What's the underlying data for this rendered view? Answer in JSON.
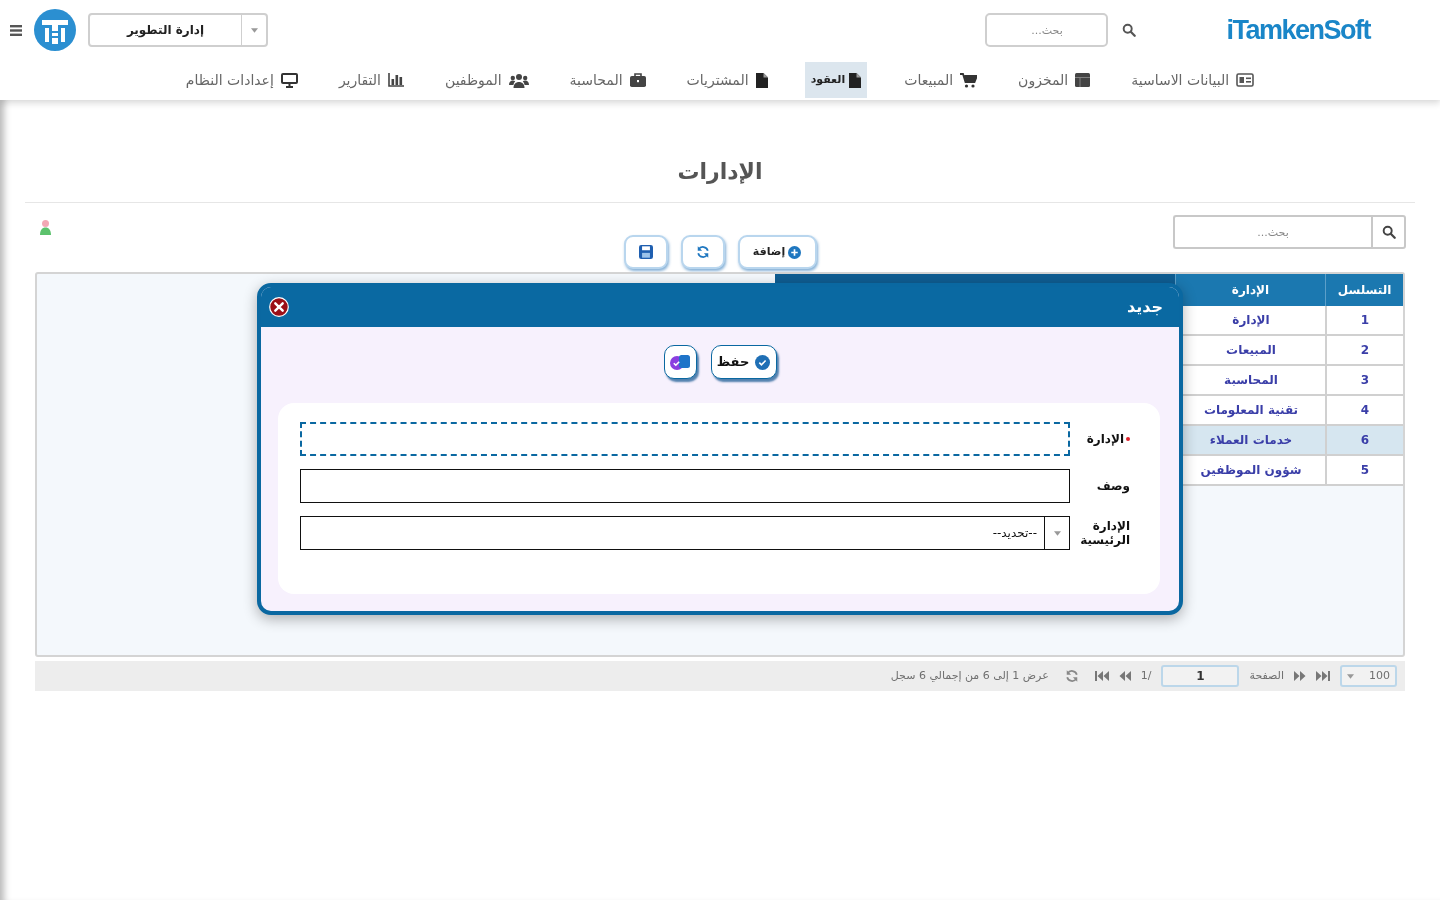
{
  "header": {
    "department_select": {
      "value": "إدارة التطوير"
    },
    "search": {
      "placeholder": "بحث..."
    },
    "brand": {
      "name": "iTamkenSoft"
    }
  },
  "nav": [
    {
      "label": "البيانات الاساسية",
      "selected": false
    },
    {
      "label": "المخزون",
      "selected": false
    },
    {
      "label": "المبيعات",
      "selected": false
    },
    {
      "label": "العقود",
      "selected": true
    },
    {
      "label": "المشتريات",
      "selected": false
    },
    {
      "label": "المحاسبة",
      "selected": false
    },
    {
      "label": "الموظفين",
      "selected": false
    },
    {
      "label": "التقارير",
      "selected": false
    },
    {
      "label": "إعدادات النظام",
      "selected": false
    }
  ],
  "page": {
    "title": "الإدارات",
    "search": {
      "placeholder": "بحث..."
    },
    "toolbar": [
      {
        "kind": "add",
        "label": "إضافة"
      },
      {
        "kind": "refresh"
      },
      {
        "kind": "save"
      }
    ]
  },
  "table": {
    "columns": [
      "التسلسل",
      "الإدارة"
    ],
    "rows": [
      {
        "cells": [
          "1",
          "الإدارة"
        ],
        "selected": false
      },
      {
        "cells": [
          "2",
          "المبيعات"
        ],
        "selected": false
      },
      {
        "cells": [
          "3",
          "المحاسبة"
        ],
        "selected": false
      },
      {
        "cells": [
          "4",
          "تقنية المعلومات"
        ],
        "selected": false
      },
      {
        "cells": [
          "6",
          "خدمات العملاء"
        ],
        "selected": true
      },
      {
        "cells": [
          "5",
          "شؤون الموظفين"
        ],
        "selected": false
      }
    ]
  },
  "pager": {
    "page_size": "100",
    "page_label": "الصفحة",
    "page": "1",
    "page_count": "/1",
    "summary": "عرض 1 إلى 6 من إجمالي 6 سجل"
  },
  "dialog": {
    "title": "جديد",
    "buttons": [
      {
        "kind": "save",
        "label": "حفظ"
      },
      {
        "kind": "save_new"
      }
    ],
    "fields": [
      {
        "kind": "text",
        "label": "الإدارة",
        "required": true,
        "focused": true
      },
      {
        "kind": "text",
        "label": "وصف",
        "required": false,
        "focused": false
      },
      {
        "kind": "select",
        "label": "الإدارة الرئيسية",
        "required": false,
        "focused": false,
        "value": "--تحديد--"
      }
    ]
  }
}
